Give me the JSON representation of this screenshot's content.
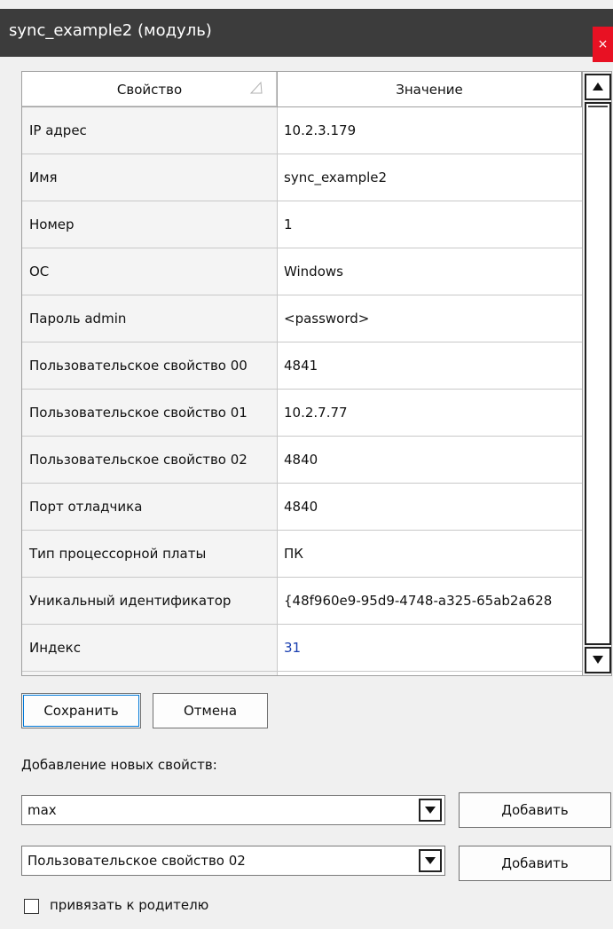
{
  "window": {
    "title": "sync_example2 (модуль)",
    "close_glyph": "×"
  },
  "grid": {
    "columns": {
      "property": "Свойство",
      "value": "Значение"
    },
    "sort_icon": "sort-triangle-icon",
    "rows": [
      {
        "property": "IP адрес",
        "value": "10.2.3.179"
      },
      {
        "property": "Имя",
        "value": "sync_example2"
      },
      {
        "property": "Номер",
        "value": "1"
      },
      {
        "property": "ОС",
        "value": "Windows"
      },
      {
        "property": "Пароль admin",
        "value": "<password>"
      },
      {
        "property": "Пользовательское свойство 00",
        "value": "4841"
      },
      {
        "property": "Пользовательское свойство 01",
        "value": "10.2.7.77"
      },
      {
        "property": "Пользовательское свойство 02",
        "value": "4840"
      },
      {
        "property": "Порт отладчика",
        "value": "4840"
      },
      {
        "property": "Тип процессорной платы",
        "value": "ПК"
      },
      {
        "property": "Уникальный идентификатор",
        "value": "{48f960e9-95d9-4748-a325-65ab2a628"
      },
      {
        "property": "Индекс",
        "value": "31"
      }
    ]
  },
  "buttons": {
    "save": "Сохранить",
    "cancel": "Отмена",
    "add": "Добавить"
  },
  "add_section": {
    "label": "Добавление новых свойств:",
    "combo1_value": "max",
    "combo2_value": "Пользовательское свойство 02"
  },
  "checkbox": {
    "label": "привязать к родителю",
    "checked": false
  },
  "colors": {
    "titlebar": "#3c3c3c",
    "close": "#e81123",
    "link_value": "#1a3fb0"
  }
}
